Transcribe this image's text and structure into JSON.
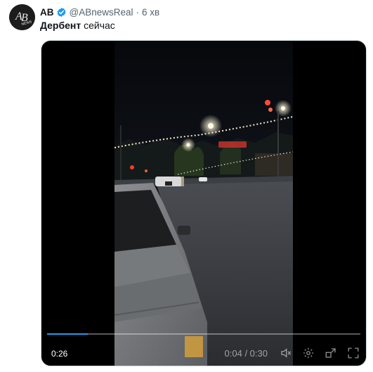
{
  "tweet": {
    "author_name": "AB",
    "handle": "@ABnewsReal",
    "separator": "·",
    "time": "6 хв",
    "text_bold": "Дербент",
    "text_rest": " сейчас",
    "avatar_logo": "AB NEWS"
  },
  "video": {
    "elapsed_overlay": "0:26",
    "time_display": "0:04 / 0:30",
    "progress": 0.13,
    "controls": [
      "mute-icon",
      "settings-icon",
      "fullscreen-exit-icon",
      "fullscreen-icon"
    ]
  },
  "colors": {
    "verified": "#1d9bf0",
    "handle": "#536471",
    "text": "#0f1419"
  }
}
